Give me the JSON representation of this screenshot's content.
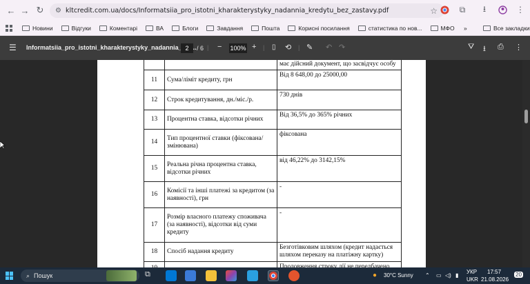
{
  "browser": {
    "url": "kltcredit.com.ua/docs/Informatsiia_pro_istotni_kharakterystyky_nadannia_kredytu_bez_zastavy.pdf",
    "bookmarks": [
      "Новини",
      "Відгуки",
      "Коментарі",
      "ВА",
      "Блоги",
      "Завдання",
      "Пошта",
      "Корисні посилання",
      "статистика по нов...",
      "МФО"
    ],
    "all_bookmarks": "Все закладки",
    "overflow": "»"
  },
  "pdf": {
    "title": "Informatsiia_pro_istotni_kharakterystyky_nadannia_kre...",
    "page": "2",
    "total": "/ 6",
    "zoom": "100%"
  },
  "table": {
    "top_cut": "має дійсний документ, що засвідчує особу",
    "rows": [
      {
        "num": "11",
        "label": "Сума/ліміт кредиту, грн",
        "value": "Від 8 648,00 до 25000,00"
      },
      {
        "num": "12",
        "label": "Строк кредитування, дн./міс./р.",
        "value": "730 днів"
      },
      {
        "num": "13",
        "label": "Процентна ставка, відсотки річних",
        "value": "Від 36,5% до 365% річних"
      },
      {
        "num": "14",
        "label": "Тип процентної ставки (фіксована/змінювана)",
        "value": "фіксована"
      },
      {
        "num": "15",
        "label": "Реальна річна процентна ставка, відсотки річних",
        "value": "від 46,22% до 3142,15%"
      },
      {
        "num": "16",
        "label": "Комісії та інші платежі за кредитом (за наявності), грн",
        "value": "-"
      },
      {
        "num": "17",
        "label": "Розмір власного платежу споживача (за наявності), відсотки від суми кредиту",
        "value": "-"
      },
      {
        "num": "18",
        "label": "Спосіб надання кредиту",
        "value": "Безготівковим шляхом (кредит надається шляхом переказу на платіжну картку)"
      },
      {
        "num": "19",
        "label": "",
        "value": "Продовження строку дії не передбачено"
      }
    ]
  },
  "taskbar": {
    "search": "Пошук",
    "weather": "30°C  Sunny",
    "lang1": "УКР",
    "lang2": "UKR",
    "time": "17:57",
    "date": "21.08.2026",
    "notif": "20"
  },
  "colors": {
    "accent": "#4cc2ff",
    "toolbar": "#3c3c3c",
    "chrome": "#f6f0f7"
  }
}
